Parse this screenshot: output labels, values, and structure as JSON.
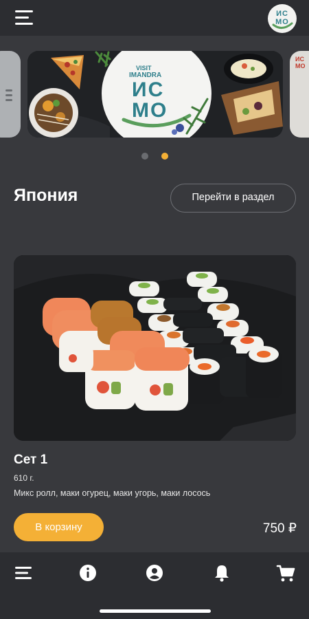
{
  "header": {
    "menu_icon": "hamburger-menu-icon",
    "logo": {
      "line1": "ИС",
      "line2": "МО"
    }
  },
  "carousel": {
    "banner": {
      "top_text": "VISIT",
      "sub_text": "IMANDRA",
      "logo_line1": "ИС",
      "logo_line2": "МО"
    },
    "next_card_text": {
      "line1": "ИС",
      "line2": "МО"
    },
    "slide_count": 2,
    "active_slide": 2
  },
  "section": {
    "title": "Япония",
    "goto_label": "Перейти в раздел"
  },
  "product": {
    "name": "Сет 1",
    "weight": "610 г.",
    "description": "Микс ролл, маки огурец, маки угорь, маки лосось",
    "cart_label": "В корзину",
    "price": "750 ₽"
  },
  "bottom_nav": {
    "items": [
      {
        "name": "menu",
        "icon": "menu-icon"
      },
      {
        "name": "info",
        "icon": "info-icon"
      },
      {
        "name": "profile",
        "icon": "account-icon"
      },
      {
        "name": "notifications",
        "icon": "bell-icon"
      },
      {
        "name": "cart",
        "icon": "cart-icon"
      }
    ]
  },
  "colors": {
    "background": "#38393d",
    "bars": "#2c2d31",
    "accent": "#f4b036",
    "brand_teal": "#2e7f8b",
    "brand_green": "#5a9e5c"
  }
}
